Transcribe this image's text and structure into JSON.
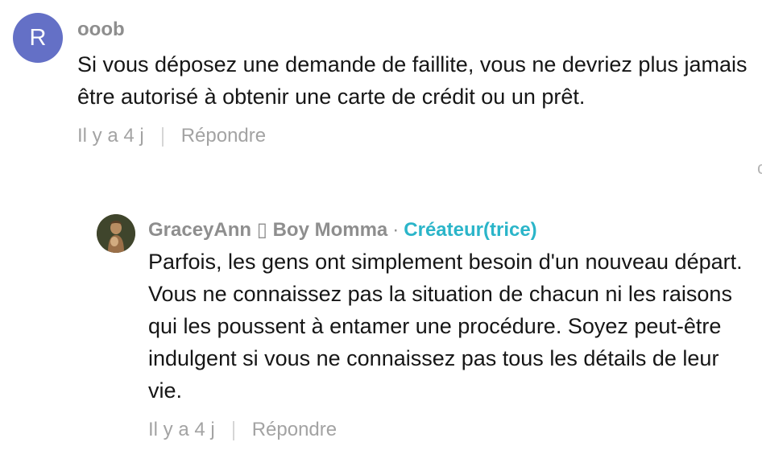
{
  "comments": [
    {
      "avatar_letter": "R",
      "username": "ooob",
      "text": "Si vous déposez une demande de faillite, vous ne devriez plus jamais être autorisé à obtenir une carte de crédit ou un prêt.",
      "age": "Il y a 4 j",
      "reply_label": "Répondre"
    }
  ],
  "replies": [
    {
      "username": "GraceyAnn ▯ Boy Momma",
      "separator": "·",
      "creator_badge": "Créateur(trice)",
      "text": "Parfois, les gens ont simplement besoin d'un nouveau départ. Vous ne connaissez pas la situation de chacun ni les raisons qui les poussent à entamer une procédure. Soyez peut-être indulgent si vous ne connaissez pas tous les détails de leur vie.",
      "age": "Il y a 4 j",
      "reply_label": "Répondre"
    }
  ],
  "colors": {
    "avatar_bg": "#6470c6",
    "creator_badge": "#2bb5c9",
    "username": "#8e8e8e",
    "meta": "#a3a3a3"
  },
  "icons": {
    "reply_avatar": "profile-photo",
    "edge_mark": "like-icon-partial"
  }
}
